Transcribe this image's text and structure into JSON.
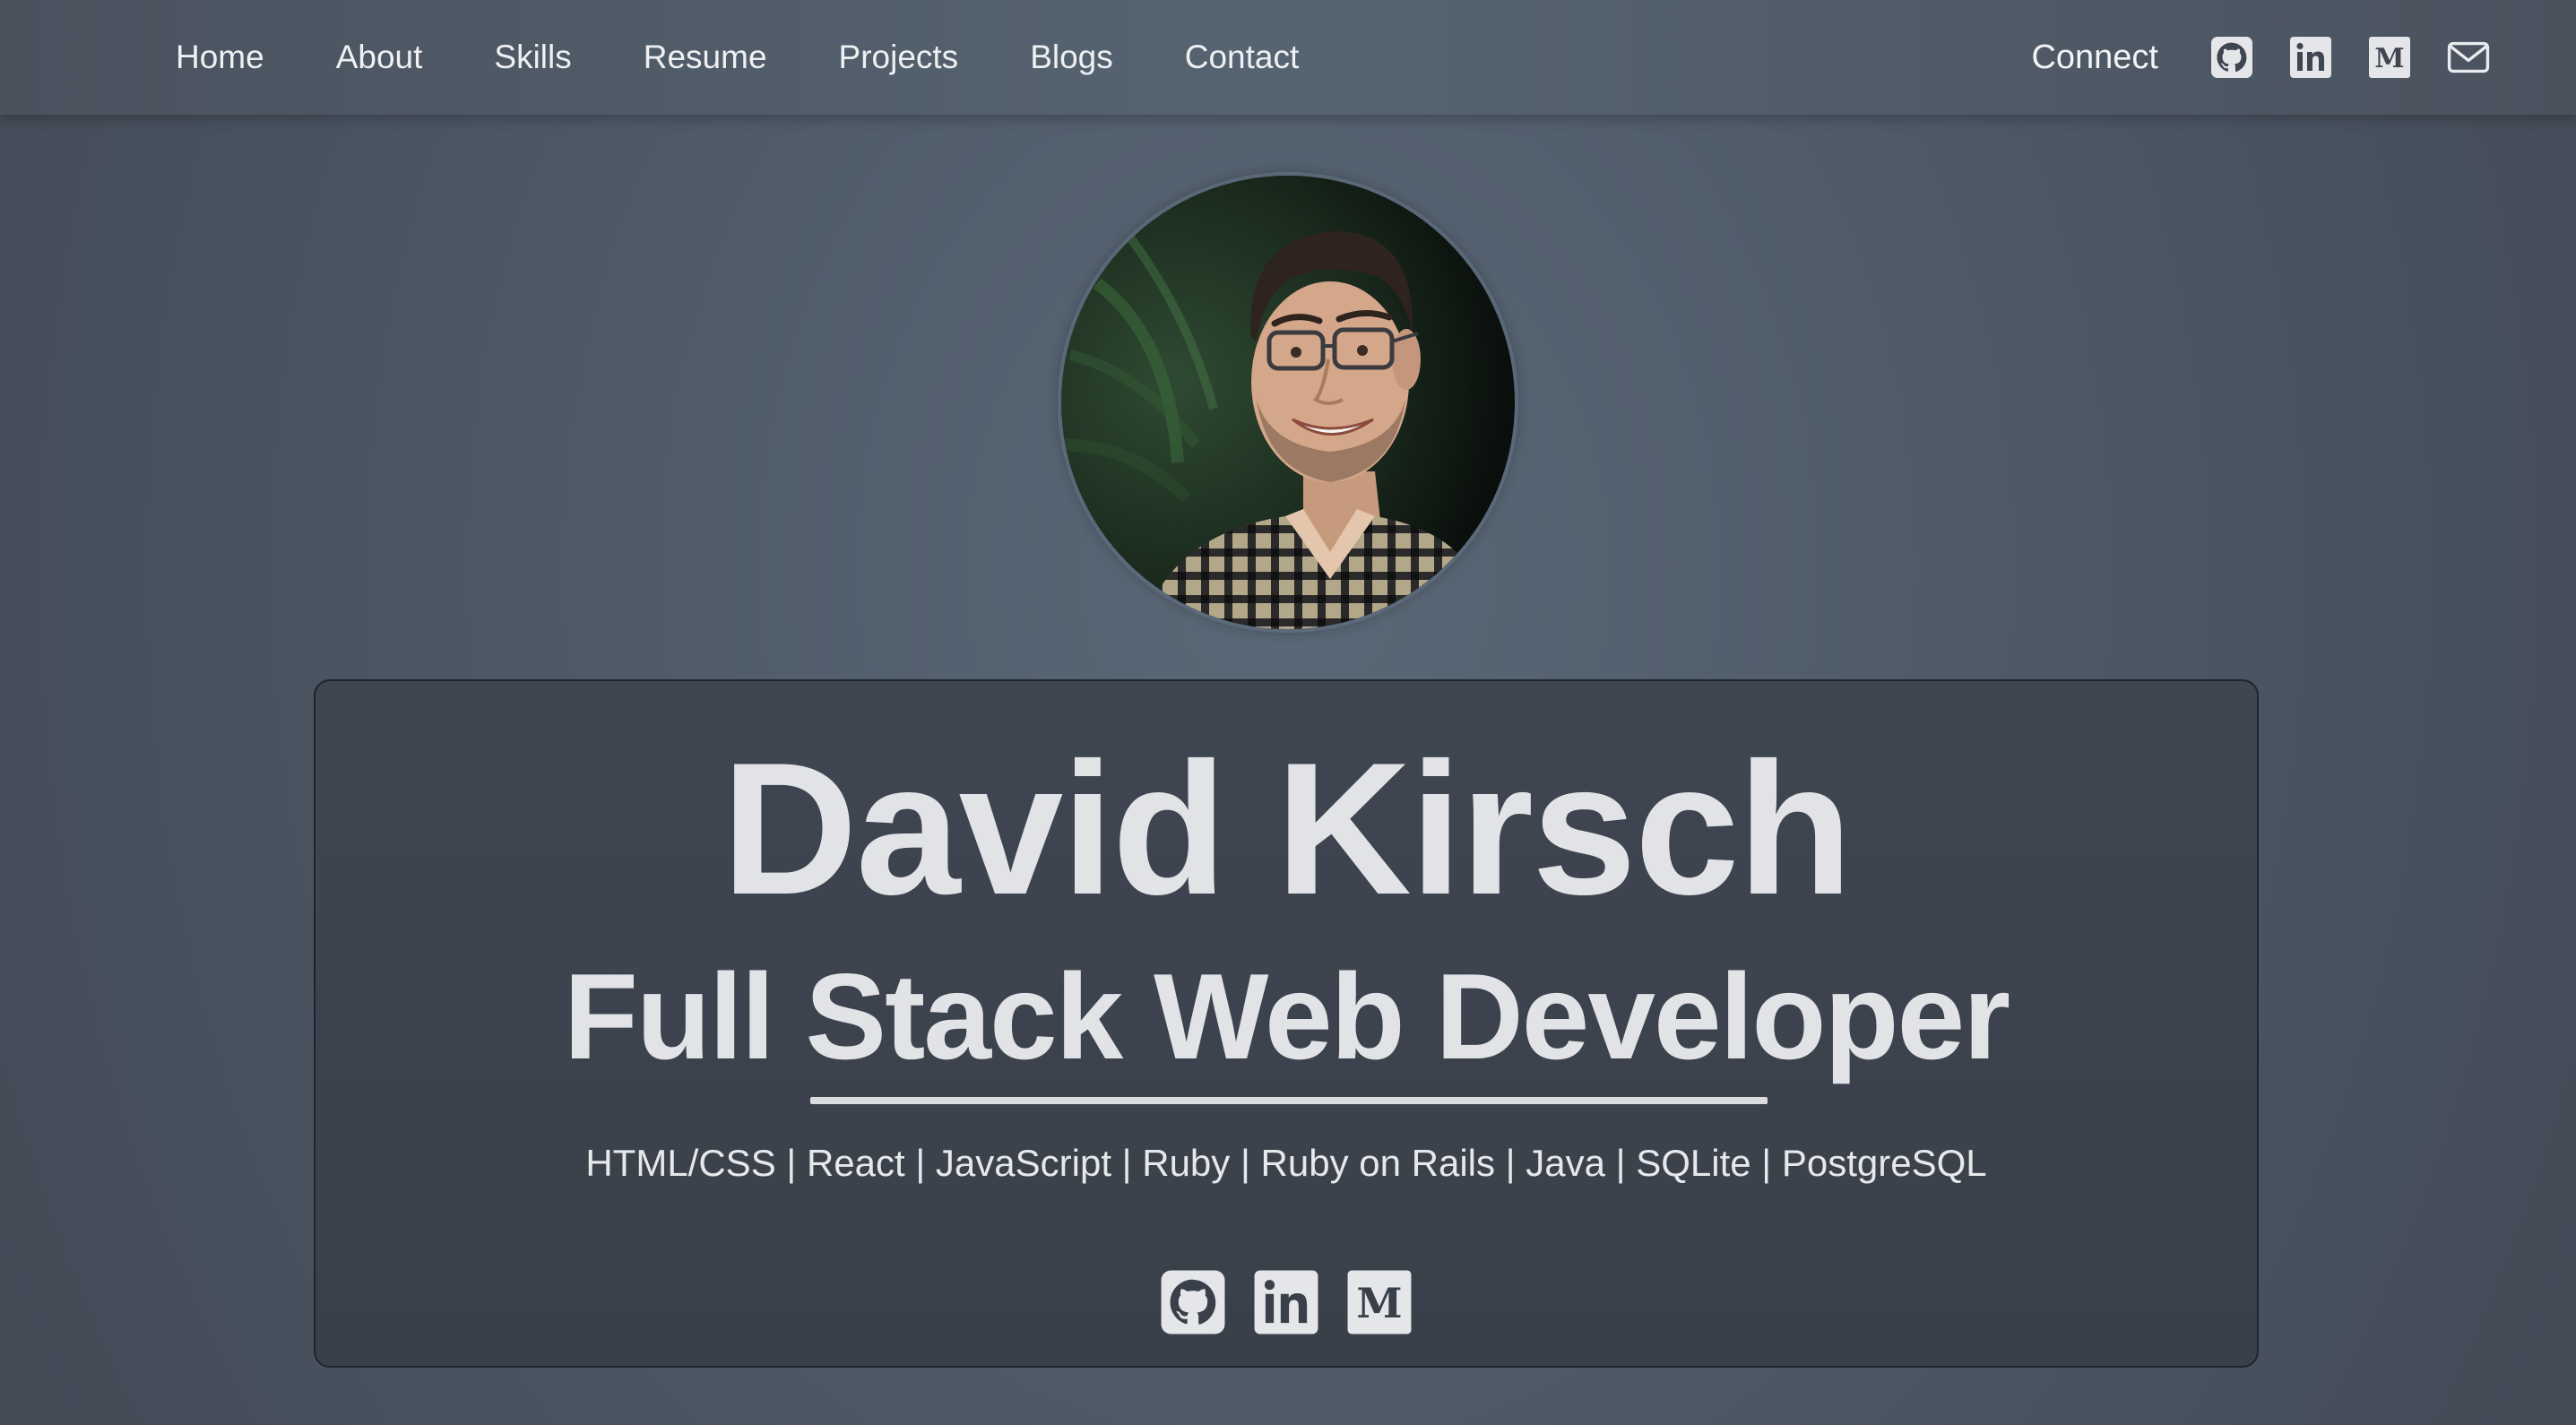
{
  "nav": {
    "links": [
      "Home",
      "About",
      "Skills",
      "Resume",
      "Projects",
      "Blogs",
      "Contact"
    ],
    "connect_label": "Connect",
    "icons": [
      "github-icon",
      "linkedin-icon",
      "medium-icon",
      "mail-icon"
    ]
  },
  "hero": {
    "name": "David Kirsch",
    "title": "Full Stack Web Developer",
    "skills": "HTML/CSS | React | JavaScript | Ruby | Ruby on Rails | Java | SQLite | PostgreSQL",
    "social_icons": [
      "github-icon",
      "linkedin-icon",
      "medium-icon"
    ]
  },
  "colors": {
    "background": "#4f5b69",
    "card": "#3d434d",
    "text": "#e1e3e6",
    "icon_fill": "#e4e6e9",
    "icon_glyph": "#3a404a"
  }
}
